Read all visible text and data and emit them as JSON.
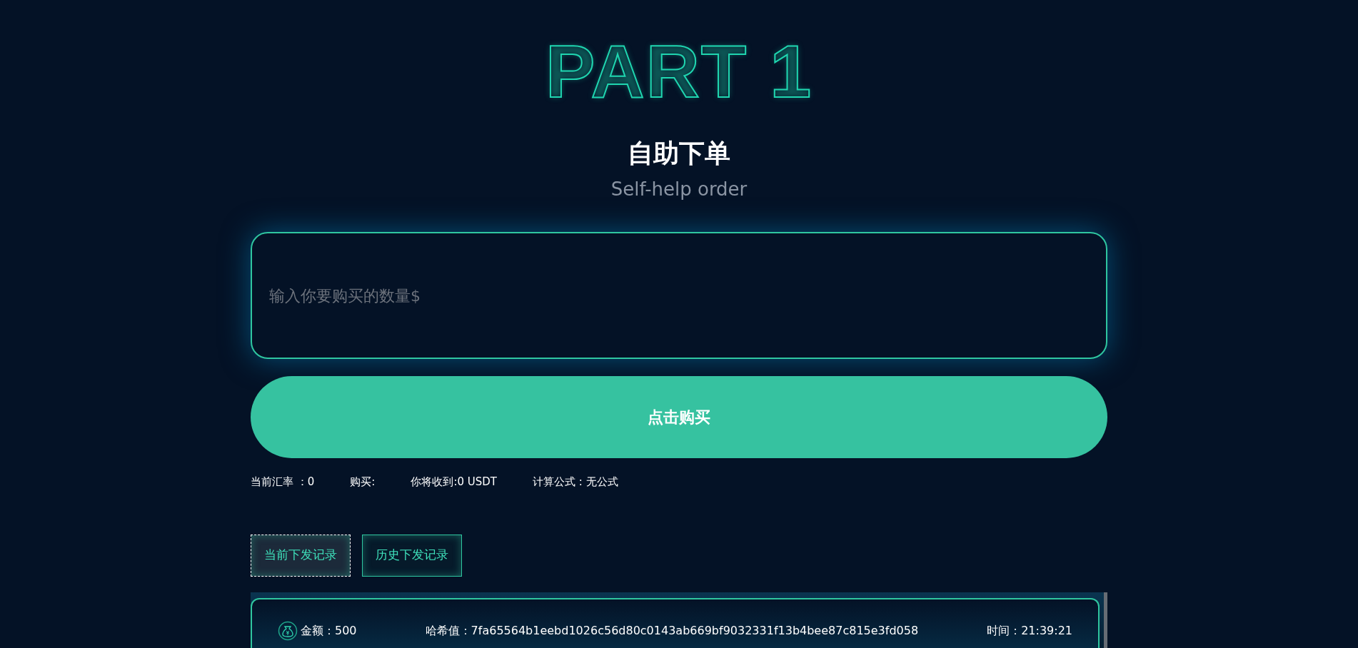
{
  "hero": {
    "title": "PART 1",
    "heading": "自助下单",
    "subheading": "Self-help order"
  },
  "order_form": {
    "amount_field": {
      "placeholder": "输入你要购买的数量$"
    },
    "buy_button": "点击购买"
  },
  "info": [
    "当前汇率 ：0",
    "购买:",
    "你将收到:0 USDT",
    "计算公式 : 无公式"
  ],
  "tabs": [
    {
      "label": "当前下发记录",
      "selected": true
    },
    {
      "label": "历史下发记录",
      "selected": false
    }
  ],
  "records": [
    {
      "amount": "金额：500",
      "hash": "哈希值：7fa65564b1eebd1026c56d80c0143ab669bf9032331f13b4bee87c815e3fd058",
      "time": "时间：21:39:21"
    }
  ]
}
